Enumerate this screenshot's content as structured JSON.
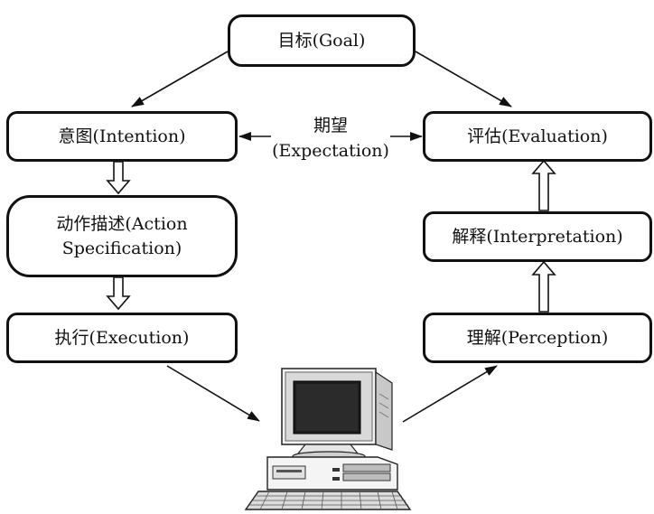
{
  "nodes": {
    "goal": "目标(Goal)",
    "intention": "意图(Intention)",
    "action_line1": "动作描述(Action",
    "action_line2": "Specification)",
    "execution": "执行(Execution)",
    "evaluation": "评估(Evaluation)",
    "interpretation": "解释(Interpretation)",
    "perception": "理解(Perception)"
  },
  "expectation": {
    "line1": "期望",
    "line2": "(Expectation)"
  },
  "computer": {
    "icon": "computer-icon"
  }
}
